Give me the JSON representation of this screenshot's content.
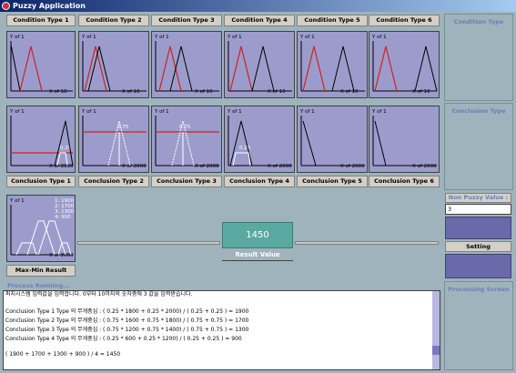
{
  "window": {
    "title": "Puzzy Application"
  },
  "condition_headers": [
    "Condition Type 1",
    "Condition Type 2",
    "Condition Type 3",
    "Condition Type 4",
    "Condition Type 5",
    "Condition Type 6"
  ],
  "conclusion_headers": [
    "Conclusion Type 1",
    "Conclusion Type 2",
    "Conclusion Type 3",
    "Conclusion Type 4",
    "Conclusion Type 5",
    "Conclusion Type 6"
  ],
  "condition_plot": {
    "y_label": "Y of 1",
    "x_label": "X of 10"
  },
  "conclusion_plot": {
    "y_label": "Y of 1",
    "x_label": "X of 2000"
  },
  "conclusion_annotations": {
    "c1": "0.25",
    "c2": "0.75",
    "c3": "0.75",
    "c4": "0.25"
  },
  "maxmin": {
    "label": "Max-Min Result",
    "y_label": "Y of 1",
    "x_label": "X of 2000",
    "legend": [
      "1: 1900",
      "2: 1700",
      "3: 1300",
      "4: 900"
    ]
  },
  "result": {
    "value": "1450",
    "label": "Result Value"
  },
  "side": {
    "condition_title": "Condition Type",
    "conclusion_title": "Conclusion Type",
    "non_puzzy_label": "Non Puzzy Value :",
    "non_puzzy_value": "3",
    "setting_label": "Setting",
    "processing_title": "Processing Screen"
  },
  "process": {
    "title": "Process Running...",
    "lines": [
      "퍼지시스템 입력값을 입력합니다. 0부터 10까지의 숫자중에 3 값을 입력받습니다.",
      "",
      "Conclusion Type 1 Type 의 무게중심 : ( 0.25 * 1800 + 0.25 * 2000) / ( 0.25 + 0.25 ) = 1900",
      "Conclusion Type 2 Type 의 무게중심 : ( 0.75 * 1600 + 0.75 * 1800) / ( 0.75 + 0.75 ) = 1700",
      "Conclusion Type 3 Type 의 무게중심 : ( 0.75 * 1200 + 0.75 * 1400) / ( 0.75 + 0.75 ) = 1300",
      "Conclusion Type 4 Type 의 무게중심 : ( 0.25 * 600 + 0.25 * 1200) / ( 0.25 + 0.25 ) = 900",
      "",
      "( 1900 + 1700 + 1300 + 900 ) / 4 = 1450"
    ]
  },
  "colors": {
    "panel": "#9c9ccc",
    "red_line": "#d02020",
    "result_box": "#5aa9a0"
  }
}
